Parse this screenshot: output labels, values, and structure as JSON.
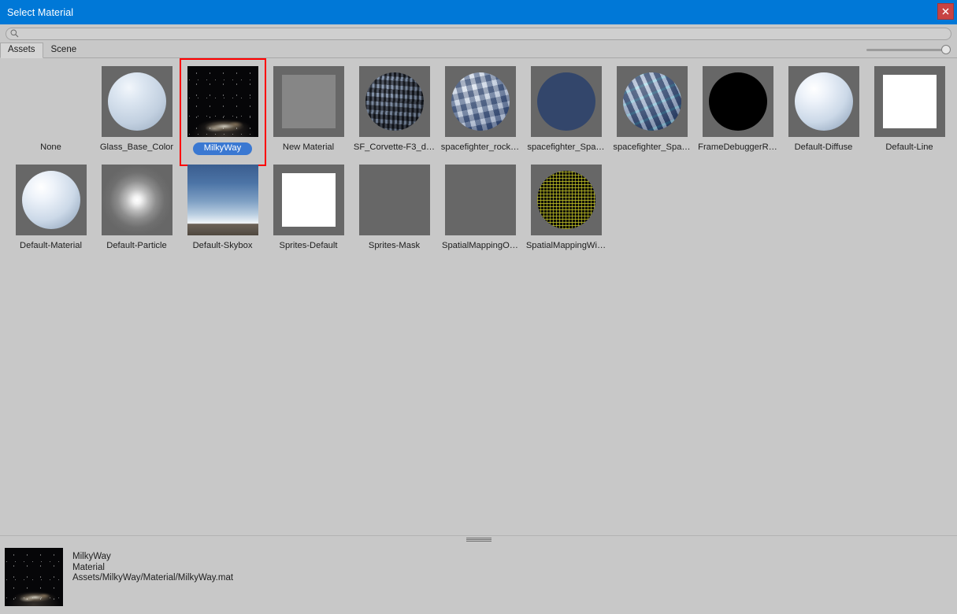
{
  "window": {
    "title": "Select Material",
    "close_icon": "close-icon",
    "accent_color": "#0078d7",
    "background_color": "#c8c8c8",
    "close_button_color": "#c74343"
  },
  "search": {
    "value": "",
    "placeholder": "",
    "icon": "search-icon"
  },
  "tabs": [
    {
      "label": "Assets",
      "selected": true
    },
    {
      "label": "Scene",
      "selected": false
    }
  ],
  "zoom_slider": {
    "name": "thumbnail-size-slider",
    "value": 100,
    "min": 0,
    "max": 100
  },
  "grid": {
    "selection_highlight_color": "#3a78d2",
    "annotation_box_color": "#ff0000",
    "items": [
      {
        "label": "None",
        "art": "none",
        "selected": false
      },
      {
        "label": "Glass_Base_Color",
        "art": "sphere-glass",
        "selected": false
      },
      {
        "label": "MilkyWay",
        "art": "milkyway",
        "selected": true,
        "annotated": true
      },
      {
        "label": "New Material",
        "art": "square-grey",
        "selected": false
      },
      {
        "label": "SF_Corvette-F3_d…",
        "art": "tex-a",
        "selected": false
      },
      {
        "label": "spacefighter_rock…",
        "art": "tex-b",
        "selected": false
      },
      {
        "label": "spacefighter_Spa…",
        "art": "tex-c",
        "selected": false
      },
      {
        "label": "spacefighter_Spa…",
        "art": "tex-d",
        "selected": false
      },
      {
        "label": "FrameDebuggerR…",
        "art": "sphere-black",
        "selected": false
      },
      {
        "label": "Default-Diffuse",
        "art": "sphere-light",
        "selected": false
      },
      {
        "label": "Default-Line",
        "art": "square-white",
        "selected": false
      },
      {
        "label": "Default-Material",
        "art": "sphere-light",
        "selected": false
      },
      {
        "label": "Default-Particle",
        "art": "particle",
        "selected": false
      },
      {
        "label": "Default-Skybox",
        "art": "skybox",
        "selected": false
      },
      {
        "label": "Sprites-Default",
        "art": "square-white",
        "selected": false
      },
      {
        "label": "Sprites-Mask",
        "art": "flat",
        "selected": false
      },
      {
        "label": "SpatialMappingO…",
        "art": "flat",
        "selected": false
      },
      {
        "label": "SpatialMappingWi…",
        "art": "wire",
        "selected": false
      }
    ]
  },
  "details": {
    "name": "MilkyWay",
    "type": "Material",
    "path": "Assets/MilkyWay/Material/MilkyWay.mat",
    "thumb_art": "milkyway"
  }
}
